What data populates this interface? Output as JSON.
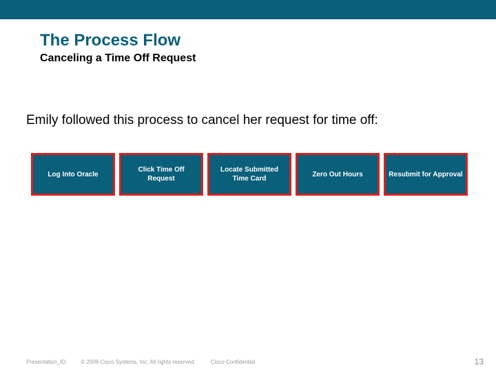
{
  "header": {
    "title": "The Process Flow",
    "subtitle": "Canceling a Time Off Request"
  },
  "body": {
    "intro": "Emily followed this process to cancel her request for time off:"
  },
  "flow": {
    "steps": [
      "Log Into Oracle",
      "Click Time Off Request",
      "Locate Submitted Time Card",
      "Zero Out Hours",
      "Resubmit for Approval"
    ]
  },
  "footer": {
    "presentation_id": "Presentation_ID",
    "copyright": "© 2006 Cisco Systems, Inc. All rights reserved.",
    "confidential": "Cisco Confidential",
    "page_number": "13"
  },
  "colors": {
    "brand": "#0a5f7a",
    "accent_border": "#d8221f"
  }
}
